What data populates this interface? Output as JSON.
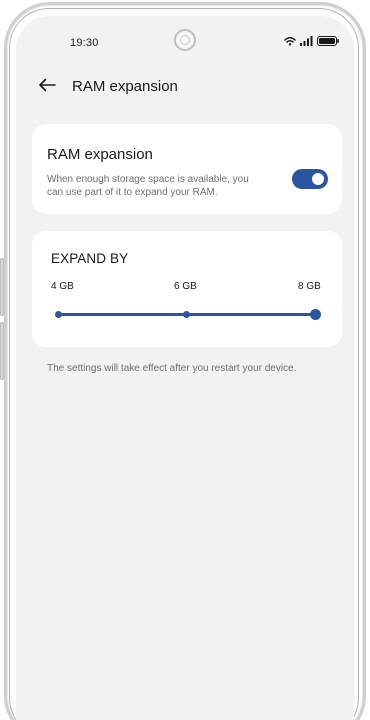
{
  "status_bar": {
    "time": "19:30",
    "icons": [
      "wifi-icon",
      "signal-icon",
      "battery-icon"
    ]
  },
  "header": {
    "back_icon": "arrow-left-icon",
    "title": "RAM expansion"
  },
  "ram_toggle": {
    "title": "RAM expansion",
    "description": "When enough storage space is available, you can use part of it to expand your RAM.",
    "enabled": true
  },
  "expand": {
    "title": "EXPAND BY",
    "options": [
      "4 GB",
      "6 GB",
      "8 GB"
    ],
    "selected_index": 2
  },
  "footnote": "The settings will take effect after you restart your device.",
  "colors": {
    "accent": "#2b55a0",
    "screen_background": "#f2f2f2",
    "card_background": "#ffffff"
  }
}
